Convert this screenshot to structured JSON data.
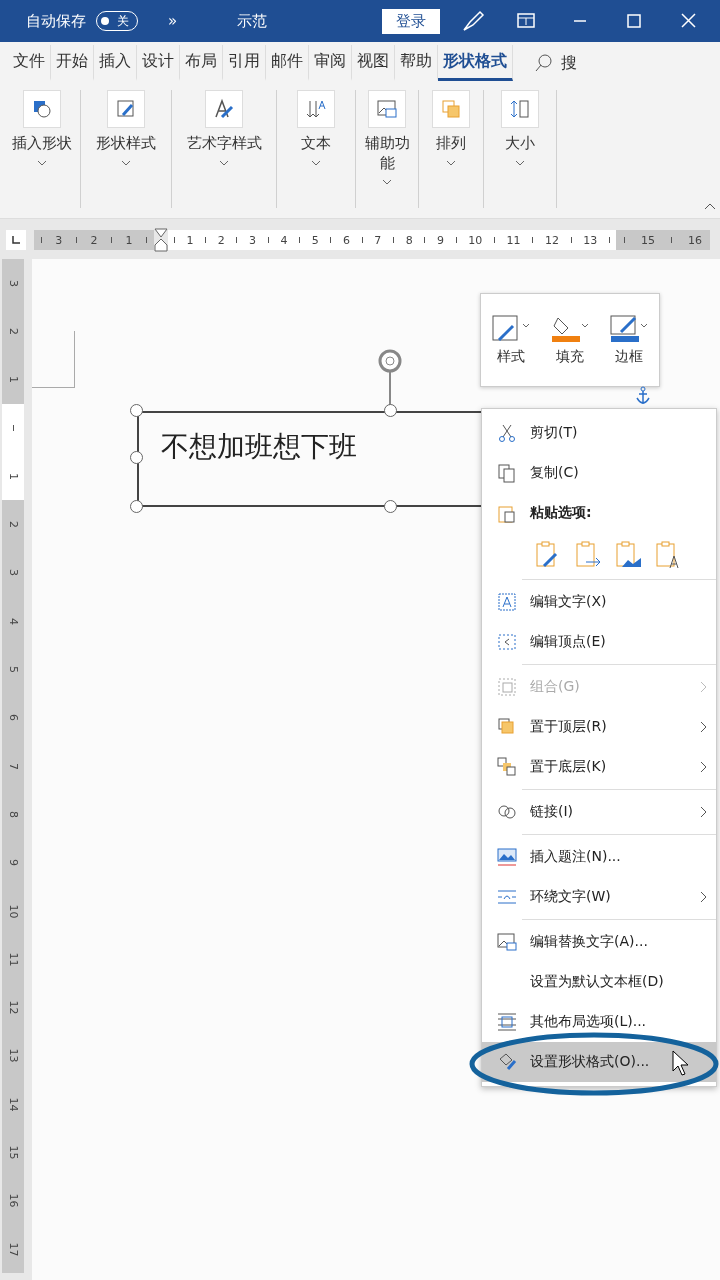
{
  "title_bar": {
    "autosave_label": "自动保存",
    "autosave_toggle": {
      "label": "关",
      "on": false
    },
    "more": "»",
    "doc_title": "示范",
    "signin": "登录"
  },
  "tabs": [
    {
      "label": "文件",
      "selected": false
    },
    {
      "label": "开始",
      "selected": false
    },
    {
      "label": "插入",
      "selected": false
    },
    {
      "label": "设计",
      "selected": false
    },
    {
      "label": "布局",
      "selected": false
    },
    {
      "label": "引用",
      "selected": false
    },
    {
      "label": "邮件",
      "selected": false
    },
    {
      "label": "审阅",
      "selected": false
    },
    {
      "label": "视图",
      "selected": false
    },
    {
      "label": "帮助",
      "selected": false
    },
    {
      "label": "形状格式",
      "selected": true
    }
  ],
  "search_label": "搜",
  "ribbon_groups": [
    {
      "label": "插入形状"
    },
    {
      "label": "形状样式"
    },
    {
      "label": "艺术字样式"
    },
    {
      "label": "文本"
    },
    {
      "label": "辅助功能"
    },
    {
      "label": "排列"
    },
    {
      "label": "大小"
    }
  ],
  "horizontal_ruler": {
    "left_numbers": [
      "3",
      "2",
      "1"
    ],
    "body_numbers": [
      "1",
      "2",
      "3",
      "4",
      "5",
      "6",
      "7",
      "8",
      "9",
      "10",
      "11",
      "12",
      "13"
    ],
    "right_numbers": [
      "15",
      "16"
    ]
  },
  "vertical_ruler": {
    "top_numbers": [
      "3",
      "2",
      "1"
    ],
    "bottom_numbers": [
      "1",
      "2",
      "3",
      "4",
      "5",
      "6",
      "7",
      "8",
      "9",
      "10",
      "11",
      "12",
      "13",
      "14",
      "15",
      "16",
      "17"
    ]
  },
  "text_box": {
    "text": "不想加班想下班"
  },
  "mini_toolbar": [
    {
      "label": "样式"
    },
    {
      "label": "填充",
      "color": "#f08010"
    },
    {
      "label": "边框",
      "color": "#2a6fc9"
    }
  ],
  "context_menu": {
    "groups": [
      [
        {
          "kind": "item",
          "label": "剪切(T)",
          "disabled": false,
          "submenu": false,
          "selected": false
        },
        {
          "kind": "item",
          "label": "复制(C)",
          "disabled": false,
          "submenu": false,
          "selected": false
        },
        {
          "kind": "header",
          "label": "粘贴选项:"
        },
        {
          "kind": "paste"
        }
      ],
      [
        {
          "kind": "item",
          "label": "编辑文字(X)",
          "disabled": false,
          "submenu": false,
          "selected": false
        },
        {
          "kind": "item",
          "label": "编辑顶点(E)",
          "disabled": false,
          "submenu": false,
          "selected": false
        }
      ],
      [
        {
          "kind": "item",
          "label": "组合(G)",
          "disabled": true,
          "submenu": true,
          "selected": false
        },
        {
          "kind": "item",
          "label": "置于顶层(R)",
          "disabled": false,
          "submenu": true,
          "selected": false
        },
        {
          "kind": "item",
          "label": "置于底层(K)",
          "disabled": false,
          "submenu": true,
          "selected": false
        }
      ],
      [
        {
          "kind": "item",
          "label": "链接(I)",
          "disabled": false,
          "submenu": true,
          "selected": false
        }
      ],
      [
        {
          "kind": "item",
          "label": "插入题注(N)...",
          "disabled": false,
          "submenu": false,
          "selected": false
        },
        {
          "kind": "item",
          "label": "环绕文字(W)",
          "disabled": false,
          "submenu": true,
          "selected": false
        }
      ],
      [
        {
          "kind": "item",
          "label": "编辑替换文字(A)...",
          "disabled": false,
          "submenu": false,
          "selected": false
        },
        {
          "kind": "item",
          "label": "设置为默认文本框(D)",
          "disabled": false,
          "submenu": false,
          "selected": false
        },
        {
          "kind": "item",
          "label": "其他布局选项(L)...",
          "disabled": false,
          "submenu": false,
          "selected": false
        },
        {
          "kind": "item",
          "label": "设置形状格式(O)...",
          "disabled": false,
          "submenu": false,
          "selected": true
        }
      ]
    ]
  }
}
